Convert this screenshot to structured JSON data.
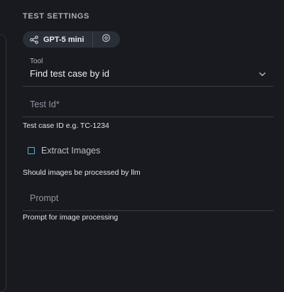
{
  "section": {
    "title": "TEST SETTINGS"
  },
  "model": {
    "name": "GPT-5 mini",
    "icon": "connection-nodes-icon",
    "settings_icon": "gear-icon"
  },
  "tool": {
    "caption": "Tool",
    "value": "Find test case by id",
    "icon": "chevron-down-icon"
  },
  "test_id": {
    "placeholder": "Test Id",
    "required_mark": "*",
    "helper": "Test case ID e.g. TC-1234"
  },
  "extract_images": {
    "label": "Extract Images",
    "checked": false,
    "helper": "Should images be processed by llm"
  },
  "prompt": {
    "placeholder": "Prompt",
    "helper": "Prompt for image processing"
  },
  "colors": {
    "background": "#181a1f",
    "accent": "#4fb8d6",
    "chip": "#2a2e36"
  }
}
